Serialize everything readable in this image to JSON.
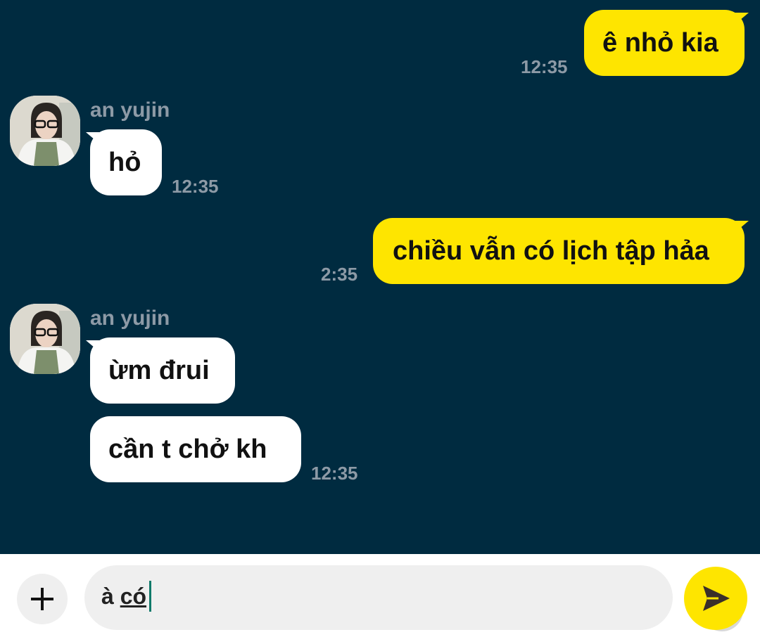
{
  "chat": {
    "messages": [
      {
        "side": "out",
        "text": "ê nhỏ kia",
        "time": "12:35"
      },
      {
        "side": "in",
        "sender": "an yujin",
        "text": "hỏ",
        "time": "12:35"
      },
      {
        "side": "out",
        "text": "chiều vẫn có lịch tập hảa",
        "time": "2:35"
      },
      {
        "side": "in",
        "sender": "an yujin",
        "text": "ừm đrui"
      },
      {
        "side": "in",
        "text": "cần t chở kh",
        "time": "12:35"
      }
    ]
  },
  "composer": {
    "text_plain": "à ",
    "text_underlined": "có"
  },
  "icons": {
    "attach": "plus-icon",
    "emoji": "smiley-icon",
    "send": "send-arrow-icon"
  },
  "colors": {
    "chat_background": "#002b40",
    "outgoing_bubble": "#fee500",
    "incoming_bubble": "#ffffff",
    "timestamp": "#8d9aa6",
    "send_button": "#fee500",
    "caret": "#117a6a"
  }
}
